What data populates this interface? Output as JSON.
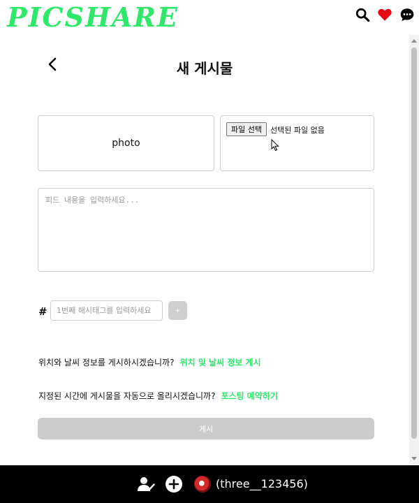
{
  "header": {
    "logo": "PICSHARE",
    "icons": [
      "search-icon",
      "heart-icon",
      "chat-icon"
    ],
    "heart_color": "#e50914",
    "accent_color": "#2ee86a"
  },
  "page": {
    "title": "새 게시물",
    "back_icon": "chevron-left-icon"
  },
  "upload": {
    "photo_label": "photo",
    "file_button_label": "파일 선택",
    "file_status": "선택된 파일 없음"
  },
  "feed": {
    "placeholder": "피드 내용을 입력하세요..."
  },
  "hashtag": {
    "symbol": "#",
    "placeholder": "1번째 해시태그를 입력하세요",
    "add_label": "+"
  },
  "location_weather": {
    "question": "위치와 날씨 정보를 게시하시겠습니까?",
    "link": "위치 및 날씨 정보 게시"
  },
  "schedule": {
    "question": "지정된 시간에 게시물을 자동으로 올리시겠습니까?",
    "link": "포스팅 예약하기"
  },
  "submit": {
    "label": "게시"
  },
  "bottom_nav": {
    "icons": [
      "user-check-icon",
      "add-circle-icon"
    ],
    "username": "(three__123456)"
  }
}
